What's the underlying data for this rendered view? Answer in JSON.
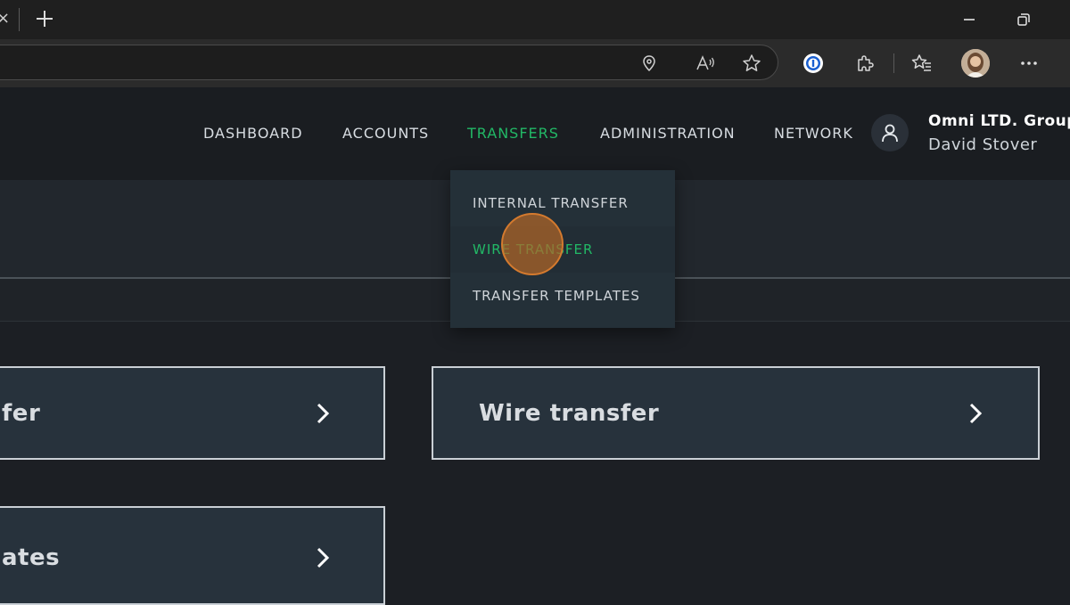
{
  "browser": {
    "new_tab_glyph": "+",
    "close_tab_glyph": "×",
    "icons": [
      "location-icon",
      "read-aloud-icon",
      "favorite-star-icon",
      "password-manager-icon",
      "extensions-icon",
      "favorites-icon",
      "profile-avatar",
      "more-icon"
    ]
  },
  "nav": {
    "items": [
      {
        "label": "DASHBOARD"
      },
      {
        "label": "ACCOUNTS"
      },
      {
        "label": "TRANSFERS"
      },
      {
        "label": "ADMINISTRATION"
      },
      {
        "label": "NETWORK"
      }
    ],
    "active": "TRANSFERS"
  },
  "user": {
    "org": "Omni LTD. Group",
    "name": "David Stover"
  },
  "dropdown": {
    "items": [
      {
        "label": "INTERNAL TRANSFER"
      },
      {
        "label": "WIRE TRANSFER"
      },
      {
        "label": "TRANSFER TEMPLATES"
      }
    ],
    "highlighted": "WIRE TRANSFER"
  },
  "cards": [
    {
      "label": "fer"
    },
    {
      "label": "Wire transfer"
    },
    {
      "label": "ates"
    }
  ],
  "colors": {
    "accent_green": "#22b866",
    "card_bg": "#27323c",
    "card_border": "#c9cfd5",
    "click_indicator": "#d47a2e"
  }
}
